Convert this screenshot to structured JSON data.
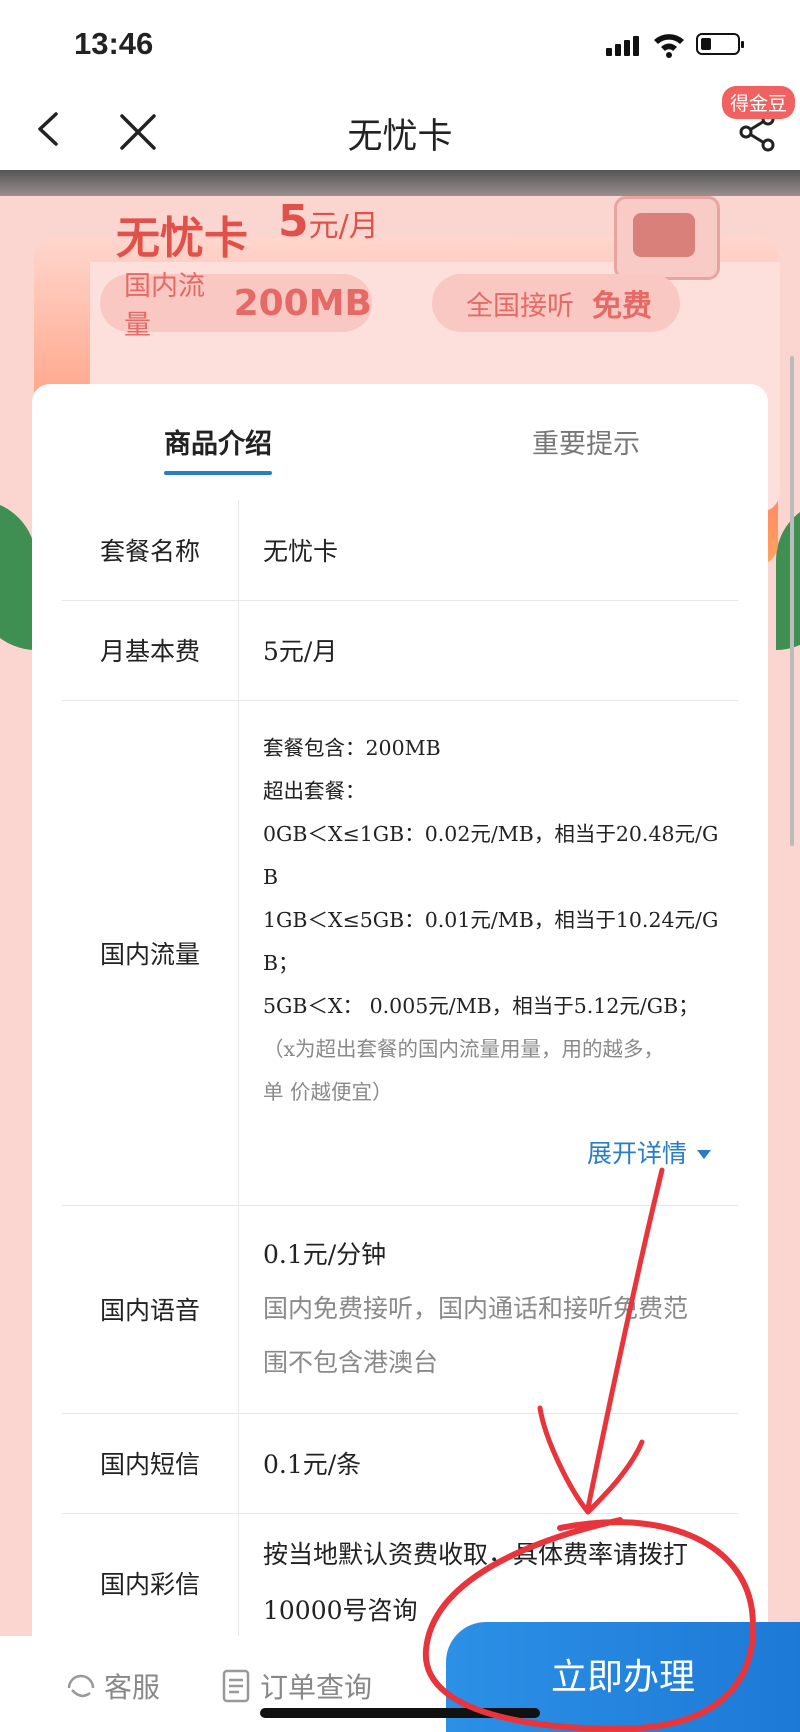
{
  "status_bar": {
    "time": "13:46"
  },
  "nav": {
    "title": "无忧卡",
    "badge": "得金豆"
  },
  "banner": {
    "name": "无忧卡",
    "price": "5",
    "price_unit": "元/月",
    "data_label": "国内流量",
    "data_value": "200MB",
    "call_label": "全国接听",
    "call_value": "免费"
  },
  "tabs": {
    "intro": "商品介绍",
    "notice": "重要提示"
  },
  "spec": {
    "plan_name": {
      "label": "套餐名称",
      "value": "无忧卡"
    },
    "monthly_fee": {
      "label": "月基本费",
      "value": "5元/月"
    },
    "domestic_data": {
      "label": "国内流量",
      "lines": [
        "套餐包含：200MB",
        "超出套餐：",
        "0GB＜X≤1GB：0.02元/MB，相当于20.48元/G",
        "B",
        "1GB＜X≤5GB：0.01元/MB，相当于10.24元/G",
        "B；",
        "5GB＜X： 0.005元/MB，相当于5.12元/GB；"
      ],
      "note_lines": [
        "（x为超出套餐的国内流量用量，用的越多，",
        "单 价越便宜）"
      ],
      "expand": "展开详情"
    },
    "domestic_voice": {
      "label": "国内语音",
      "value": "0.1元/分钟",
      "note_lines": [
        "国内免费接听，国内通话和接听免费范",
        "围不包含港澳台"
      ]
    },
    "domestic_sms": {
      "label": "国内短信",
      "value": "0.1元/条"
    },
    "domestic_mms": {
      "label": "国内彩信",
      "lines": [
        "按当地默认资费收取，具体费率请拨打",
        "10000号咨询"
      ]
    }
  },
  "bottom_bar": {
    "service": "客服",
    "orders": "订单查询",
    "apply": "立即办理"
  },
  "colors": {
    "accent_blue": "#2a7cc5",
    "cta_blue": "#1e80dc",
    "annotation_red": "#e8353b"
  }
}
